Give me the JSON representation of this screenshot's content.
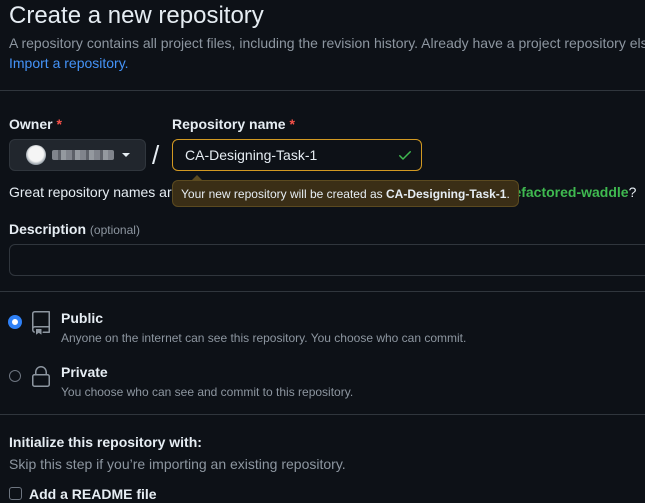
{
  "header": {
    "title": "Create a new repository",
    "intro": "A repository contains all project files, including the revision history. Already have a project repository elsewhere?",
    "import_link": "Import a repository."
  },
  "owner": {
    "label": "Owner",
    "required_mark": "*",
    "slash": "/"
  },
  "repo_name": {
    "label": "Repository name",
    "required_mark": "*",
    "value": "CA-Designing-Task-1",
    "valid_icon": "check-icon",
    "valid_color": "#3fb950"
  },
  "hint": {
    "prefix": "Great repository names are",
    "suggestion_name": "refactored-waddle",
    "suggestion_suffix": "?"
  },
  "tooltip": {
    "prefix": "Your new repository will be created as",
    "name": "CA-Designing-Task-1",
    "suffix": "."
  },
  "description": {
    "label": "Description",
    "optional": "(optional)",
    "value": ""
  },
  "visibility": {
    "selected": "public",
    "options": [
      {
        "key": "public",
        "title": "Public",
        "desc": "Anyone on the internet can see this repository. You choose who can commit.",
        "icon": "repo-icon"
      },
      {
        "key": "private",
        "title": "Private",
        "desc": "You choose who can see and commit to this repository.",
        "icon": "lock-icon"
      }
    ]
  },
  "initialize": {
    "title": "Initialize this repository with:",
    "desc": "Skip this step if you’re importing an existing repository.",
    "readme_label": "Add a README file",
    "readme_checked": false
  },
  "colors": {
    "background": "#0d1117",
    "accent": "#2f81f7",
    "link": "#4493f8",
    "warning_border": "#d29922",
    "success": "#3fb950",
    "danger": "#f85149"
  }
}
